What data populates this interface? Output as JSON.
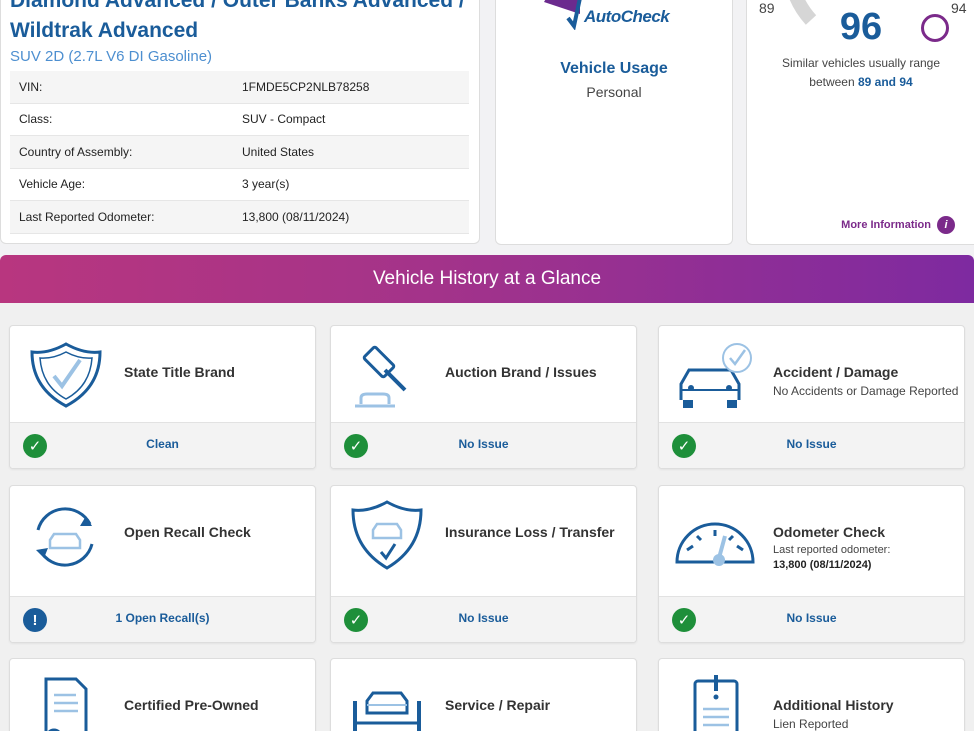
{
  "vehicle": {
    "title_line1": "Diamond Advanced / Outer Banks Advanced /",
    "title_line2": "Wildtrak Advanced",
    "subtitle": "SUV 2D (2.7L V6 DI Gasoline)",
    "specs": [
      {
        "key": "VIN:",
        "value": "1FMDE5CP2NLB78258"
      },
      {
        "key": "Class:",
        "value": "SUV - Compact"
      },
      {
        "key": "Country of Assembly:",
        "value": "United States"
      },
      {
        "key": "Vehicle Age:",
        "value": "3 year(s)"
      },
      {
        "key": "Last Reported Odometer:",
        "value": "13,800 (08/11/2024)"
      }
    ]
  },
  "autocheck": {
    "logo_text": "AutoCheck",
    "usage_title": "Vehicle Usage",
    "usage_value": "Personal"
  },
  "score": {
    "min": "89",
    "max": "94",
    "value": "96",
    "desc_line1": "Similar vehicles usually range",
    "desc_prefix": "between",
    "desc_range": "89 and 94",
    "more_info": "More Information"
  },
  "banner": {
    "title": "Vehicle History at a Glance"
  },
  "tiles": [
    {
      "title": "State Title Brand",
      "status": "Clean",
      "icon": "shield-check-icon",
      "status_type": "ok"
    },
    {
      "title": "Auction Brand / Issues",
      "status": "No Issue",
      "icon": "gavel-icon",
      "status_type": "ok"
    },
    {
      "title": "Accident / Damage",
      "sub": "No Accidents or Damage Reported",
      "status": "No Issue",
      "icon": "car-check-icon",
      "status_type": "ok"
    },
    {
      "title": "Open Recall Check",
      "status": "1 Open Recall(s)",
      "icon": "recall-car-icon",
      "status_type": "warn"
    },
    {
      "title": "Insurance Loss / Transfer",
      "status": "No Issue",
      "icon": "shield-car-icon",
      "status_type": "ok"
    },
    {
      "title": "Odometer Check",
      "sub": "Last reported odometer:",
      "sub2": "13,800 (08/11/2024)",
      "status": "No Issue",
      "icon": "odometer-icon",
      "status_type": "ok"
    },
    {
      "title": "Certified Pre-Owned",
      "icon": "certificate-icon"
    },
    {
      "title": "Service / Repair",
      "icon": "car-lift-icon"
    },
    {
      "title": "Additional History",
      "sub": "Lien Reported",
      "icon": "clipboard-alert-icon"
    }
  ],
  "colors": {
    "accent_blue": "#1a5c9a",
    "ok_green": "#1e8f3a",
    "purple": "#7b2a8a"
  }
}
